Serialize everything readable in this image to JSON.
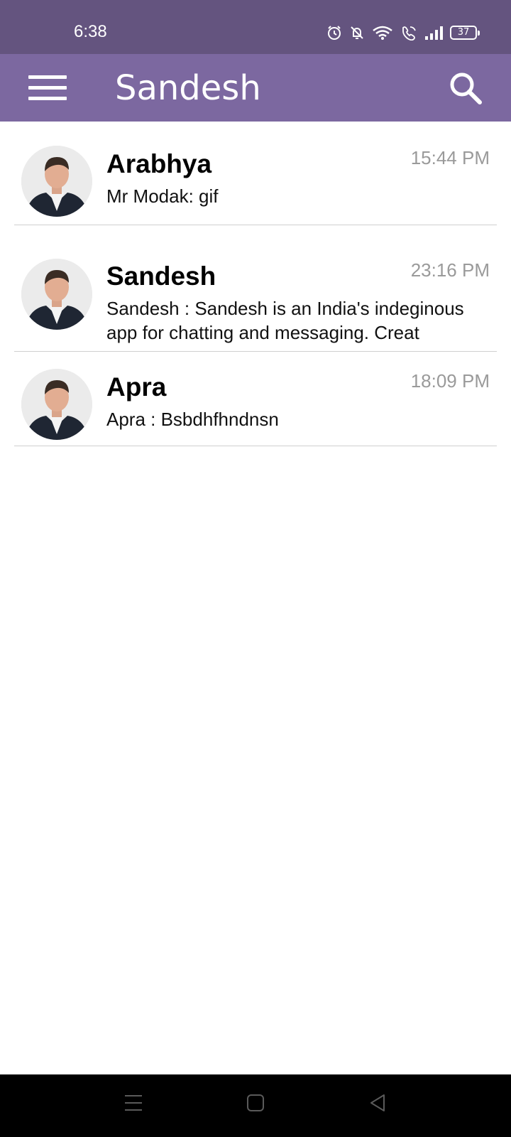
{
  "status_bar": {
    "time": "6:38",
    "battery": "37",
    "icons": [
      "alarm-icon",
      "bell-muted-icon",
      "wifi-icon",
      "wifi-call-icon",
      "signal-icon",
      "battery-icon"
    ]
  },
  "app_bar": {
    "title": "Sandesh",
    "menu_icon": "hamburger-menu-icon",
    "search_icon": "search-icon"
  },
  "chats": [
    {
      "name": "Arabhya",
      "time": "15:44 PM",
      "preview": "Mr Modak: gif"
    },
    {
      "name": "Sandesh",
      "time": "23:16 PM",
      "preview": "Sandesh : Sandesh is an India's indeginous app for chatting and messaging. Creat"
    },
    {
      "name": "Apra",
      "time": "18:09 PM",
      "preview": "Apra : Bsbdhfhndnsn"
    }
  ],
  "nav_bar": {
    "icons": [
      "recents-menu-icon",
      "home-icon",
      "back-icon"
    ]
  },
  "colors": {
    "status_bar": "#64547f",
    "app_bar": "#7c68a0",
    "time_text": "#9a9a9a",
    "divider": "#cfcfcf"
  }
}
